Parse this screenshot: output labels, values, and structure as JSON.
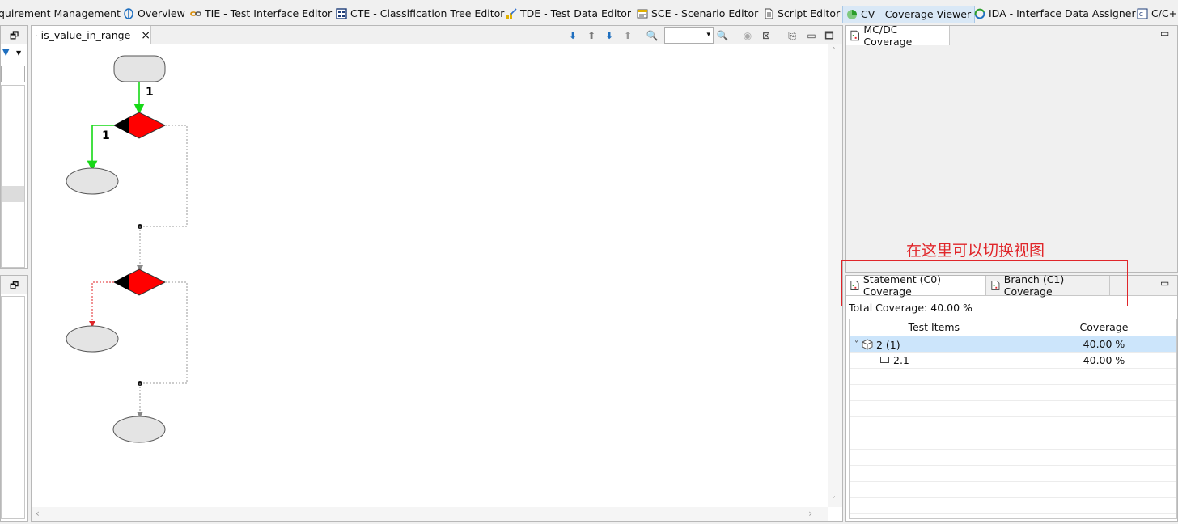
{
  "perspectives": [
    {
      "label": "quirement Management",
      "icon": "requirement-icon",
      "active": false
    },
    {
      "label": "Overview",
      "icon": "overview-icon",
      "active": false
    },
    {
      "label": "TIE - Test Interface Editor",
      "icon": "tie-icon",
      "active": false
    },
    {
      "label": "CTE - Classification Tree Editor",
      "icon": "cte-icon",
      "active": false
    },
    {
      "label": "TDE - Test Data Editor",
      "icon": "tde-icon",
      "active": false
    },
    {
      "label": "SCE - Scenario Editor",
      "icon": "sce-icon",
      "active": false
    },
    {
      "label": "Script Editor",
      "icon": "script-icon",
      "active": false
    },
    {
      "label": "CV - Coverage Viewer",
      "icon": "cv-icon",
      "active": true
    },
    {
      "label": "IDA - Interface Data Assigner",
      "icon": "ida-icon",
      "active": false
    },
    {
      "label": "C/C+",
      "icon": "cpp-icon",
      "active": false
    }
  ],
  "editor": {
    "tab_label": "is_value_in_range",
    "flow": {
      "edge_label_1": "1",
      "edge_label_2": "1"
    }
  },
  "mcdc_panel": {
    "tab_label": "MC/DC Coverage"
  },
  "coverage_panel": {
    "tabs": [
      {
        "label": "Statement (C0) Coverage"
      },
      {
        "label": "Branch (C1) Coverage"
      }
    ],
    "total_coverage": "Total Coverage: 40.00 %",
    "columns": [
      "Test Items",
      "Coverage"
    ],
    "rows": [
      {
        "item": "2 (1)",
        "coverage": "40.00 %"
      },
      {
        "item": "2.1",
        "coverage": "40.00 %"
      }
    ]
  },
  "annotation": {
    "text": "在这里可以切换视图",
    "color": "#e0262a"
  },
  "colors": {
    "covered_edge": "#16d816",
    "uncovered_edge": "#e0262a",
    "decision_fill": "#ff0000",
    "node_fill": "#e4e4e4",
    "selection": "#cce5fb"
  }
}
